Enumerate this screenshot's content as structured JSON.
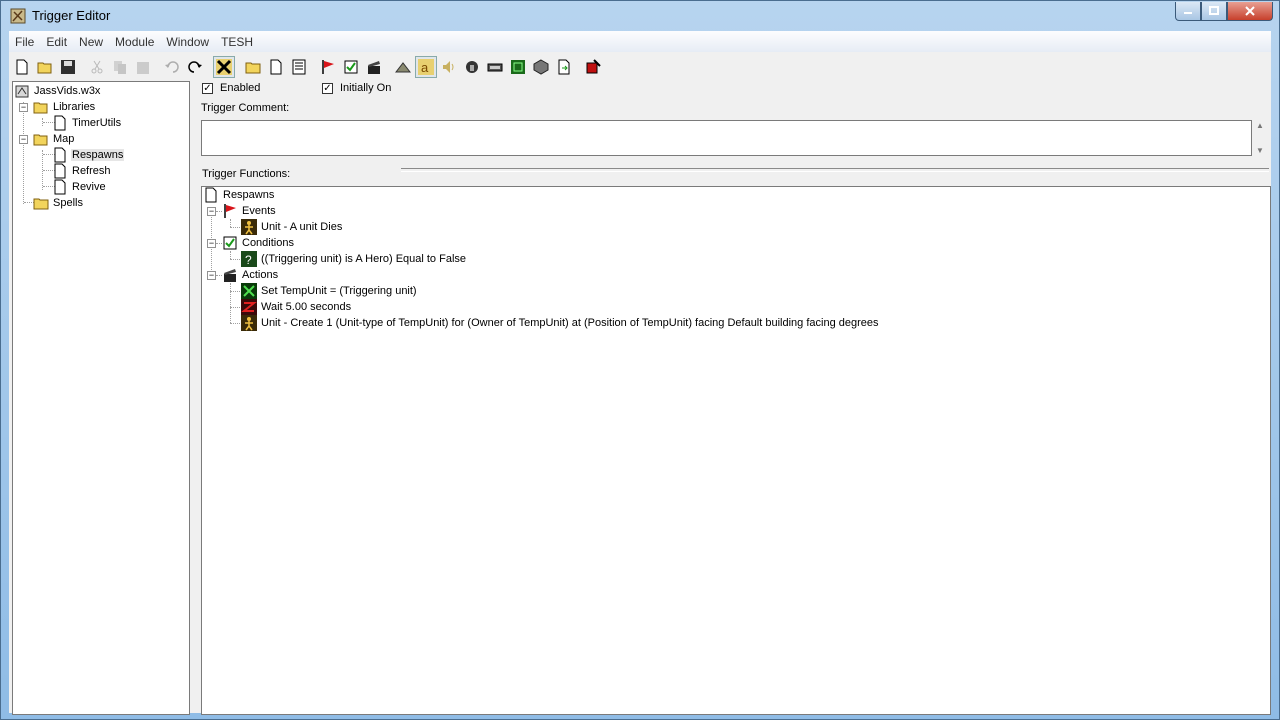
{
  "window": {
    "title": "Trigger Editor"
  },
  "menu": [
    "File",
    "Edit",
    "New",
    "Module",
    "Window",
    "TESH"
  ],
  "left_tree": {
    "root": "JassVids.w3x",
    "libraries": "Libraries",
    "timerutils": "TimerUtils",
    "map": "Map",
    "respawns": "Respawns",
    "refresh": "Refresh",
    "revive": "Revive",
    "spells": "Spells"
  },
  "trigger": {
    "enabled_label": "Enabled",
    "enabled_checked": true,
    "initially_on_label": "Initially On",
    "initially_on_checked": true,
    "comment_label": "Trigger Comment:",
    "comment": "",
    "functions_label": "Trigger Functions:"
  },
  "functions_tree": {
    "name": "Respawns",
    "events": "Events",
    "event_1": "Unit - A unit Dies",
    "conditions": "Conditions",
    "condition_1": "((Triggering unit) is A Hero) Equal to False",
    "actions": "Actions",
    "action_1": "Set TempUnit = (Triggering unit)",
    "action_2": "Wait 5.00 seconds",
    "action_3": "Unit - Create 1 (Unit-type of TempUnit) for (Owner of TempUnit) at (Position of TempUnit) facing Default building facing degrees"
  },
  "colors": {
    "accent_selection": "#e6e6e6",
    "event_flag": "#d8141a",
    "unit_icon_bg": "#3a2a08"
  }
}
